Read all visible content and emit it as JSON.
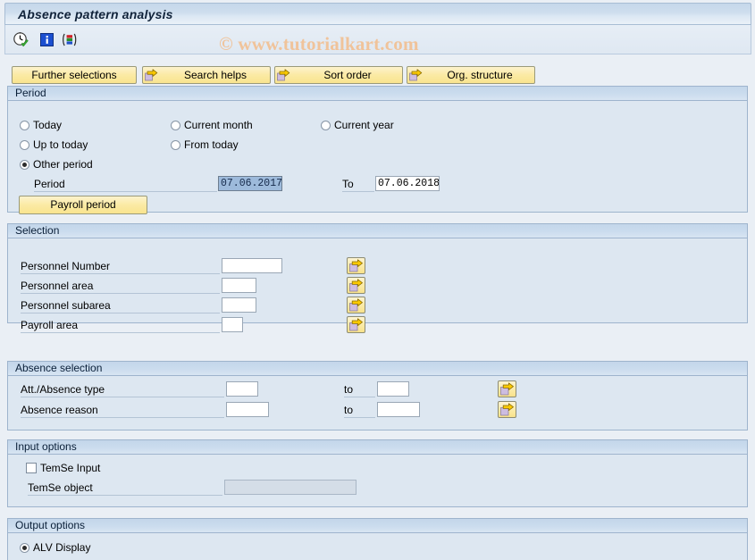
{
  "window": {
    "title": "Absence pattern analysis"
  },
  "watermark": {
    "text": "© www.tutorialkart.com"
  },
  "toolbar": {
    "icons": [
      {
        "name": "execute-clock-icon",
        "title": "Execute"
      },
      {
        "name": "info-icon",
        "title": "Information"
      },
      {
        "name": "variants-icon",
        "title": "Get Variant"
      }
    ]
  },
  "buttons": {
    "further_selections": "Further selections",
    "search_helps": "Search helps",
    "sort_order": "Sort order",
    "org_structure": "Org. structure"
  },
  "period": {
    "header": "Period",
    "options": [
      {
        "label": "Today",
        "selected": false
      },
      {
        "label": "Current month",
        "selected": false
      },
      {
        "label": "Current year",
        "selected": false
      },
      {
        "label": "Up to today",
        "selected": false
      },
      {
        "label": "From today",
        "selected": false
      },
      {
        "label": "Other period",
        "selected": true
      }
    ],
    "period_label": "Period",
    "period_from_value": "07.06.2017",
    "to_label": "To",
    "period_to_value": "07.06.2018",
    "payroll_period_button": "Payroll period"
  },
  "selection": {
    "header": "Selection",
    "rows": [
      {
        "label": "Personnel Number",
        "value": ""
      },
      {
        "label": "Personnel area",
        "value": ""
      },
      {
        "label": "Personnel subarea",
        "value": ""
      },
      {
        "label": "Payroll area",
        "value": ""
      }
    ]
  },
  "absence_selection": {
    "header": "Absence selection",
    "to_label": "to",
    "rows": [
      {
        "label": "Att./Absence type",
        "from": "",
        "to": ""
      },
      {
        "label": "Absence reason",
        "from": "",
        "to": ""
      }
    ]
  },
  "input_options": {
    "header": "Input options",
    "temse_input_label": "TemSe Input",
    "temse_input_checked": false,
    "temse_object_label": "TemSe object",
    "temse_object_value": ""
  },
  "output_options": {
    "header": "Output options",
    "alv_display_label": "ALV Display",
    "alv_display_selected": true
  },
  "colors": {
    "panel_bg": "#dde7f1",
    "panel_border": "#9eb4cd",
    "button_yellow": "#fbeaa4",
    "accent_blue": "#9dbadb",
    "watermark": "#f0c39a"
  }
}
